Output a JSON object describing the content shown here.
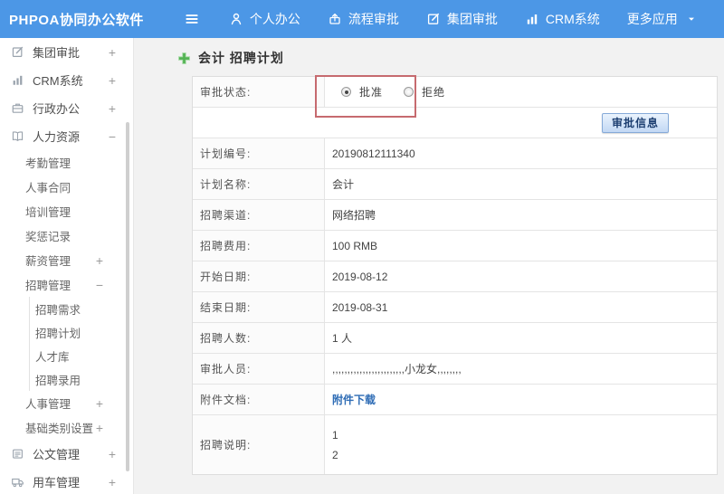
{
  "colors": {
    "topbar_blue": "#4c97e6",
    "annotation_red": "#c66a6f",
    "link_blue": "#2e6cb5",
    "button_face": "#c2d8f4"
  },
  "topbar": {
    "logo": "PHPOA协同办公软件",
    "menu": [
      {
        "label": "个人办公",
        "icon": "person"
      },
      {
        "label": "流程审批",
        "icon": "process"
      },
      {
        "label": "集团审批",
        "icon": "edit-square"
      },
      {
        "label": "CRM系统",
        "icon": "bar-chart"
      },
      {
        "label": "更多应用",
        "icon": null,
        "caret": true
      }
    ]
  },
  "sidebar": {
    "items": [
      {
        "label": "集团审批",
        "icon": "edit-square",
        "level": 1,
        "toggle": "+"
      },
      {
        "label": "CRM系统",
        "icon": "bar-chart",
        "level": 1,
        "toggle": "+"
      },
      {
        "label": "行政办公",
        "icon": "briefcase",
        "level": 1,
        "toggle": "+"
      },
      {
        "label": "人力资源",
        "icon": "book",
        "level": 1,
        "toggle": "−"
      },
      {
        "label": "考勤管理",
        "level": 2
      },
      {
        "label": "人事合同",
        "level": 2
      },
      {
        "label": "培训管理",
        "level": 2
      },
      {
        "label": "奖惩记录",
        "level": 2
      },
      {
        "label": "薪资管理",
        "level": 2,
        "toggle": "+"
      },
      {
        "label": "招聘管理",
        "level": 2,
        "toggle": "−"
      },
      {
        "label": "招聘需求",
        "level": 3
      },
      {
        "label": "招聘计划",
        "level": 3
      },
      {
        "label": "人才库",
        "level": 3
      },
      {
        "label": "招聘录用",
        "level": 3
      },
      {
        "label": "人事管理",
        "level": 2,
        "toggle": "+"
      },
      {
        "label": "基础类别设置",
        "level": 2,
        "toggle": "+"
      },
      {
        "label": "公文管理",
        "icon": "document",
        "level": 1,
        "toggle": "+"
      },
      {
        "label": "用车管理",
        "icon": "truck",
        "level": 1,
        "toggle": "+"
      }
    ]
  },
  "main": {
    "title": "会计 招聘计划",
    "approval_row": {
      "label": "审批状态:",
      "options": [
        {
          "label": "批准",
          "selected": true
        },
        {
          "label": "拒绝",
          "selected": false
        }
      ]
    },
    "approve_button": "审批信息",
    "rows": [
      {
        "label": "计划编号:",
        "value": "20190812111340"
      },
      {
        "label": "计划名称:",
        "value": "会计"
      },
      {
        "label": "招聘渠道:",
        "value": "网络招聘"
      },
      {
        "label": "招聘费用:",
        "value": "100 RMB"
      },
      {
        "label": "开始日期:",
        "value": "2019-08-12"
      },
      {
        "label": "结束日期:",
        "value": "2019-08-31"
      },
      {
        "label": "招聘人数:",
        "value": "1 人"
      },
      {
        "label": "审批人员:",
        "value": ",,,,,,,,,,,,,,,,,,,,,,,,小龙女,,,,,,,,"
      },
      {
        "label": "附件文档:",
        "value": "附件下载",
        "type": "link"
      },
      {
        "label": "招聘说明:",
        "lines": [
          "1",
          "2"
        ],
        "type": "multiline"
      }
    ]
  }
}
